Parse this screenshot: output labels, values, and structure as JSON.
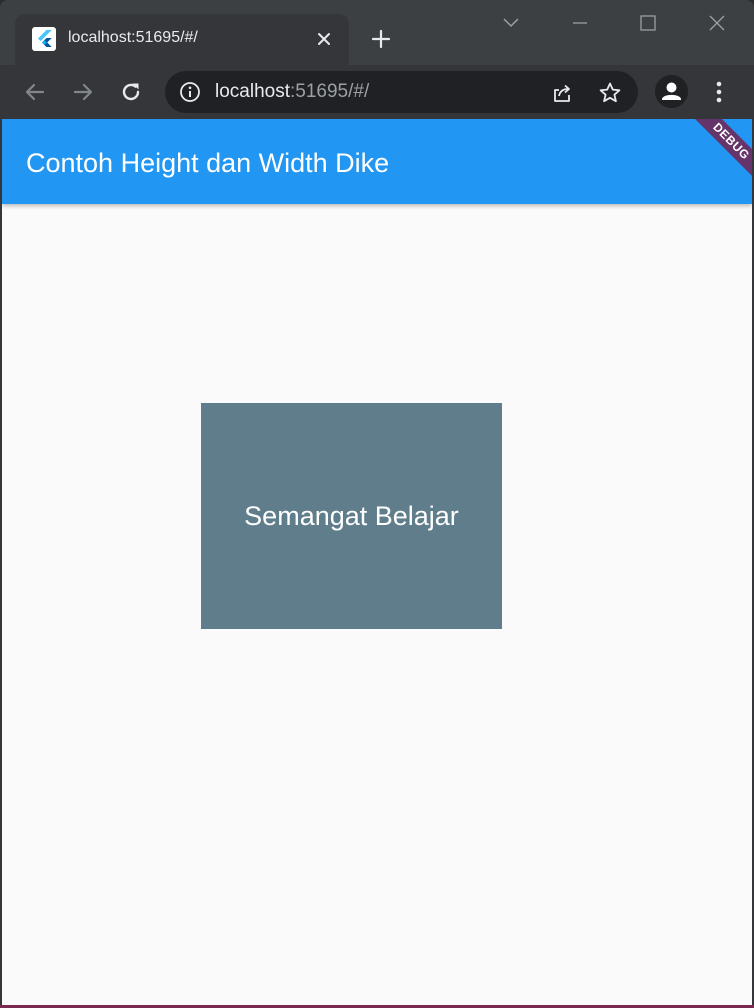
{
  "browser": {
    "tab": {
      "title": "localhost:51695/#/"
    },
    "address_bar": {
      "host": "localhost",
      "rest": ":51695/#/"
    }
  },
  "app": {
    "appbar_title": "Contoh Height dan Width Dike",
    "debug_banner": "DEBUG",
    "box_text": "Semangat Belajar"
  },
  "colors": {
    "appbar": "#2196f3",
    "box": "#607d8b",
    "background": "#fafafa",
    "debug_banner": "#88002080"
  },
  "icons": {
    "favicon": "flutter-logo-icon",
    "tab_close": "close-icon",
    "new_tab": "plus-icon",
    "back": "arrow-left-icon",
    "forward": "arrow-right-icon",
    "reload": "reload-icon",
    "site_info": "info-icon",
    "share": "share-icon",
    "bookmark": "star-icon",
    "profile": "person-icon",
    "menu": "kebab-menu-icon"
  }
}
